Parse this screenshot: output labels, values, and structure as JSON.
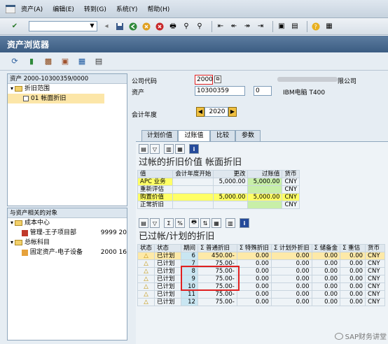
{
  "menu": {
    "items": [
      "资产(A)",
      "编辑(E)",
      "转到(G)",
      "系统(Y)",
      "帮助(H)"
    ]
  },
  "title": "资产浏览器",
  "tree": {
    "header": "资产 2000-10300359/0000",
    "nodes": [
      "折旧范围",
      "01 帐面折旧"
    ],
    "related_header": "与资产相关的对象",
    "related": [
      {
        "label": "成本中心",
        "value": ""
      },
      {
        "label": "管理-王子项目部",
        "value": "9999 20"
      },
      {
        "label": "总帐科目",
        "value": ""
      },
      {
        "label": "固定资产-电子设备",
        "value": "2000 16"
      }
    ]
  },
  "form": {
    "company_label": "公司代码",
    "company_value": "2000",
    "company_name": "限公司",
    "asset_label": "资产",
    "asset_value": "10300359",
    "sub_value": "0",
    "asset_desc": "IBM电脑 T400",
    "fy_label": "会计年度",
    "fy_value": "2020"
  },
  "tabs": [
    "计划价值",
    "过账值",
    "比较",
    "参数"
  ],
  "section1_title": "过帐的折旧价值 帐面折旧",
  "table1": {
    "headers": [
      "值",
      "会计年度开始",
      "更改",
      "过账值",
      "货币"
    ],
    "rows": [
      [
        "APC 业务",
        "",
        "5,000.00",
        "5,000.00",
        "CNY"
      ],
      [
        "重新评估",
        "",
        "",
        "",
        "CNY"
      ],
      [
        "购置价值",
        "",
        "5,000.00",
        "5,000.00",
        "CNY"
      ],
      [
        "正常折旧",
        "",
        "",
        "",
        "CNY"
      ]
    ]
  },
  "section2_title": "已过帐/计划的折旧",
  "table2": {
    "headers": [
      "状态",
      "状态",
      "期间",
      "Σ 普通折旧",
      "Σ 特殊折旧",
      "Σ 计划外折旧",
      "Σ 储备金",
      "Σ 重估",
      "货币"
    ],
    "rows": [
      [
        "△",
        "已计划",
        "6",
        "450.00-",
        "0.00",
        "0.00",
        "0.00",
        "0.00",
        "CNY"
      ],
      [
        "△",
        "已计划",
        "7",
        "75.00-",
        "0.00",
        "0.00",
        "0.00",
        "0.00",
        "CNY"
      ],
      [
        "△",
        "已计划",
        "8",
        "75.00-",
        "0.00",
        "0.00",
        "0.00",
        "0.00",
        "CNY"
      ],
      [
        "△",
        "已计划",
        "9",
        "75.00-",
        "0.00",
        "0.00",
        "0.00",
        "0.00",
        "CNY"
      ],
      [
        "△",
        "已计划",
        "10",
        "75.00-",
        "0.00",
        "0.00",
        "0.00",
        "0.00",
        "CNY"
      ],
      [
        "△",
        "已计划",
        "11",
        "75.00-",
        "0.00",
        "0.00",
        "0.00",
        "0.00",
        "CNY"
      ],
      [
        "△",
        "已计划",
        "12",
        "75.00-",
        "0.00",
        "0.00",
        "0.00",
        "0.00",
        "CNY"
      ]
    ]
  },
  "watermark": "SAP财务讲堂"
}
